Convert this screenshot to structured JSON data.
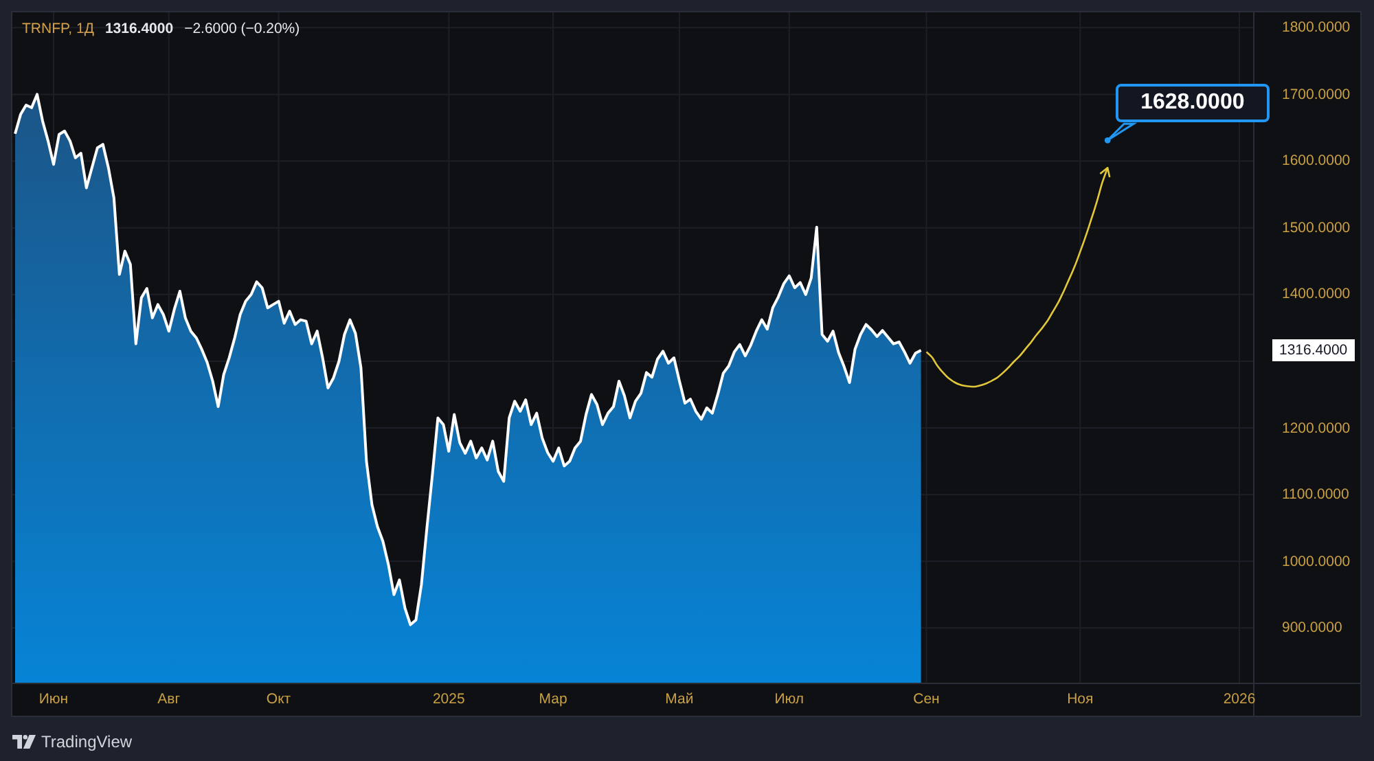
{
  "chart": {
    "legend": {
      "price": "1316.4000",
      "change": "−2.6000 (−0.20%)"
    },
    "last_price_label": "1316.4000",
    "chart_data": {
      "type": "area",
      "title": "TRNFP, 1Д",
      "categories": [
        null,
        null,
        null,
        null,
        null,
        null,
        null,
        "Июн",
        null,
        null,
        null,
        null,
        null,
        null,
        null,
        null,
        null,
        null,
        null,
        null,
        null,
        null,
        null,
        null,
        null,
        null,
        null,
        null,
        "Авг",
        null,
        null,
        null,
        null,
        null,
        null,
        null,
        null,
        null,
        null,
        null,
        null,
        null,
        null,
        null,
        null,
        null,
        null,
        null,
        "Окт",
        null,
        null,
        null,
        null,
        null,
        null,
        null,
        null,
        null,
        null,
        null,
        null,
        null,
        null,
        null,
        null,
        null,
        null,
        null,
        null,
        null,
        null,
        null,
        null,
        null,
        null,
        null,
        null,
        null,
        null,
        "2025",
        null,
        null,
        null,
        null,
        null,
        null,
        null,
        null,
        null,
        null,
        null,
        null,
        null,
        null,
        null,
        null,
        null,
        null,
        "Мар",
        null,
        null,
        null,
        null,
        null,
        null,
        null,
        null,
        null,
        null,
        null,
        null,
        null,
        null,
        null,
        null,
        null,
        null,
        null,
        null,
        null,
        null,
        "Май",
        null,
        null,
        null,
        null,
        null,
        null,
        null,
        null,
        null,
        null,
        null,
        null,
        null,
        null,
        null,
        null,
        null,
        null,
        null,
        "Июл",
        null,
        null,
        null,
        null,
        null,
        null,
        null,
        null,
        null,
        null,
        null,
        null,
        null,
        null,
        null,
        null,
        null,
        null,
        null,
        null,
        null,
        null,
        null,
        null,
        "Сен",
        null,
        null,
        null,
        null,
        null,
        null,
        null,
        null,
        null,
        null,
        null,
        null,
        null,
        null,
        null,
        null,
        null,
        null,
        null,
        null,
        null,
        null,
        null,
        null,
        null,
        null,
        null,
        "Ноя",
        null,
        null,
        null,
        null,
        null,
        null,
        null,
        null,
        null,
        null,
        null,
        null,
        null,
        null,
        null,
        null,
        null,
        null,
        null,
        null,
        null,
        null,
        null,
        null,
        null,
        null,
        null,
        null,
        "2026",
        null,
        null
      ],
      "series": [
        {
          "color": "#ffffff",
          "values": [
            1641,
            1670,
            1684,
            1680,
            1700,
            1660,
            1630,
            1595,
            1640,
            1645,
            1630,
            1605,
            1612,
            1560,
            1590,
            1620,
            1625,
            1590,
            1545,
            1430,
            1465,
            1445,
            1326,
            1395,
            1409,
            1365,
            1385,
            1370,
            1345,
            1378,
            1405,
            1365,
            1345,
            1335,
            1318,
            1298,
            1270,
            1232,
            1280,
            1305,
            1335,
            1370,
            1390,
            1400,
            1419,
            1410,
            1380,
            1385,
            1390,
            1357,
            1375,
            1355,
            1362,
            1360,
            1326,
            1345,
            1305,
            1260,
            1275,
            1300,
            1340,
            1362,
            1342,
            1290,
            1150,
            1085,
            1052,
            1030,
            995,
            950,
            972,
            930,
            905,
            912,
            965,
            1050,
            1130,
            1215,
            1205,
            1165,
            1220,
            1178,
            1162,
            1180,
            1155,
            1170,
            1152,
            1180,
            1135,
            1120,
            1215,
            1240,
            1225,
            1242,
            1205,
            1222,
            1185,
            1163,
            1150,
            1170,
            1143,
            1150,
            1170,
            1180,
            1220,
            1250,
            1235,
            1205,
            1222,
            1232,
            1270,
            1248,
            1215,
            1240,
            1252,
            1283,
            1276,
            1303,
            1315,
            1297,
            1305,
            1270,
            1237,
            1243,
            1225,
            1213,
            1230,
            1222,
            1250,
            1282,
            1293,
            1314,
            1325,
            1308,
            1324,
            1345,
            1362,
            1348,
            1380,
            1396,
            1416,
            1428,
            1410,
            1418,
            1400,
            1425,
            1501,
            1340,
            1330,
            1345,
            1313,
            1292,
            1268,
            1318,
            1340,
            1355,
            1347,
            1337,
            1346,
            1336,
            1326,
            1329,
            1314,
            1297,
            1312,
            1316.4,
            null,
            null,
            null,
            null,
            null,
            null,
            null,
            null,
            null,
            null,
            null,
            null,
            null,
            null,
            null,
            null,
            null,
            null,
            null,
            null,
            null,
            null,
            null,
            null,
            null,
            null,
            null,
            null,
            null,
            null,
            null,
            null,
            null,
            null,
            null,
            null,
            null,
            null,
            null,
            null,
            null,
            null,
            null,
            null,
            null,
            null,
            null,
            null,
            null,
            null,
            null,
            null,
            null,
            null,
            null,
            null,
            null,
            null,
            null,
            null
          ]
        },
        {
          "type": "line",
          "color": "#e3c83a",
          "values": [
            null,
            null,
            null,
            null,
            null,
            null,
            null,
            null,
            null,
            null,
            null,
            null,
            null,
            null,
            null,
            null,
            null,
            null,
            null,
            null,
            null,
            null,
            null,
            null,
            null,
            null,
            null,
            null,
            null,
            null,
            null,
            null,
            null,
            null,
            null,
            null,
            null,
            null,
            null,
            null,
            null,
            null,
            null,
            null,
            null,
            null,
            null,
            null,
            null,
            null,
            null,
            null,
            null,
            null,
            null,
            null,
            null,
            null,
            null,
            null,
            null,
            null,
            null,
            null,
            null,
            null,
            null,
            null,
            null,
            null,
            null,
            null,
            null,
            null,
            null,
            null,
            null,
            null,
            null,
            null,
            null,
            null,
            null,
            null,
            null,
            null,
            null,
            null,
            null,
            null,
            null,
            null,
            null,
            null,
            null,
            null,
            null,
            null,
            null,
            null,
            null,
            null,
            null,
            null,
            null,
            null,
            null,
            null,
            null,
            null,
            null,
            null,
            null,
            null,
            null,
            null,
            null,
            null,
            null,
            null,
            null,
            null,
            null,
            null,
            null,
            null,
            null,
            null,
            null,
            null,
            null,
            null,
            null,
            null,
            null,
            null,
            null,
            null,
            null,
            null,
            null,
            null,
            null,
            null,
            null,
            null,
            null,
            null,
            null,
            null,
            null,
            null,
            null,
            null,
            null,
            null,
            null,
            null,
            null,
            null,
            null,
            null,
            null,
            null,
            null,
            null,
            1314,
            1306,
            1293,
            1283,
            1275,
            1269,
            1265,
            1263,
            1262,
            1262,
            1264,
            1267,
            1271,
            1276,
            1283,
            1291,
            1300,
            1308,
            1318,
            1328,
            1339,
            1349,
            1360,
            1374,
            1388,
            1405,
            1423,
            1442,
            1464,
            1487,
            1512,
            1538,
            1567,
            1590,
            null,
            null,
            null,
            null,
            null,
            null,
            null,
            null,
            null,
            null,
            null,
            null,
            null,
            null,
            null,
            null,
            null,
            null,
            null,
            null,
            null,
            null,
            null,
            null,
            null,
            null
          ]
        }
      ],
      "ylim": [
        818,
        1823
      ],
      "yticks": [
        {
          "value": 1800,
          "label": "1800.0000"
        },
        {
          "value": 1700,
          "label": "1700.0000"
        },
        {
          "value": 1600,
          "label": "1600.0000"
        },
        {
          "value": 1500,
          "label": "1500.0000"
        },
        {
          "value": 1400,
          "label": "1400.0000"
        },
        {
          "value": 1200,
          "label": "1200.0000"
        },
        {
          "value": 1100,
          "label": "1100.0000"
        },
        {
          "value": 1000,
          "label": "1000.0000"
        },
        {
          "value": 900,
          "label": "900.0000"
        }
      ],
      "grid": true,
      "annotations": [
        "1628.0000"
      ]
    }
  },
  "footer": {
    "brand": "TradingView"
  }
}
